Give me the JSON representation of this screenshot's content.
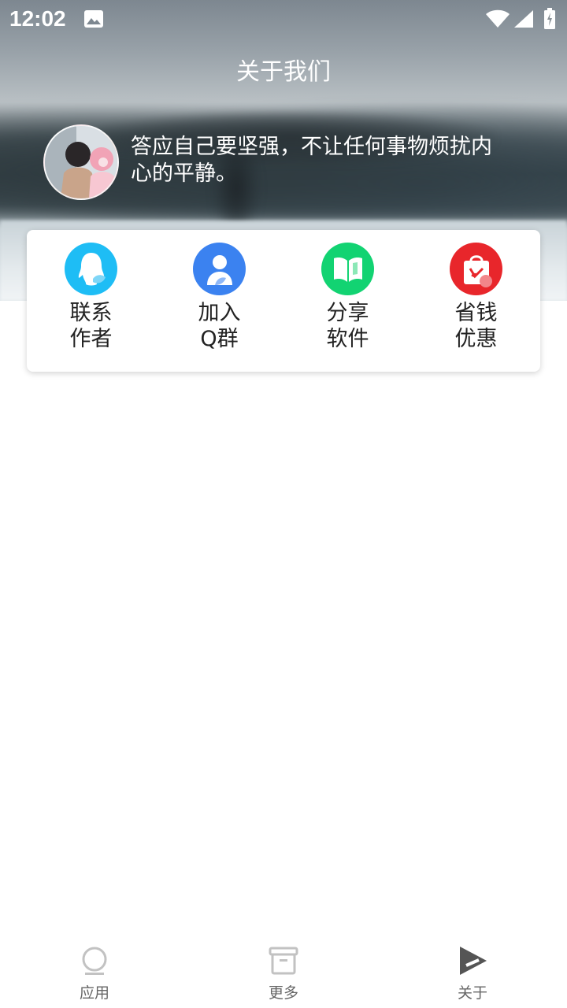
{
  "status_bar": {
    "time": "12:02"
  },
  "header": {
    "title": "关于我们",
    "motto": "答应自己要坚强，不让任何事物烦扰内心的平静。"
  },
  "actions": [
    {
      "label": "联系作者",
      "icon": "qq-icon",
      "color": "#1EBDF5"
    },
    {
      "label": "加入Q群",
      "icon": "group-icon",
      "color": "#3B82F0"
    },
    {
      "label": "分享软件",
      "icon": "book-icon",
      "color": "#12D372"
    },
    {
      "label": "省钱优惠",
      "icon": "shopping-bag-icon",
      "color": "#E8262B"
    }
  ],
  "bottom_nav": {
    "tabs": [
      {
        "label": "应用",
        "icon": "circle-icon"
      },
      {
        "label": "更多",
        "icon": "archive-icon"
      },
      {
        "label": "关于",
        "icon": "play-icon"
      }
    ]
  }
}
